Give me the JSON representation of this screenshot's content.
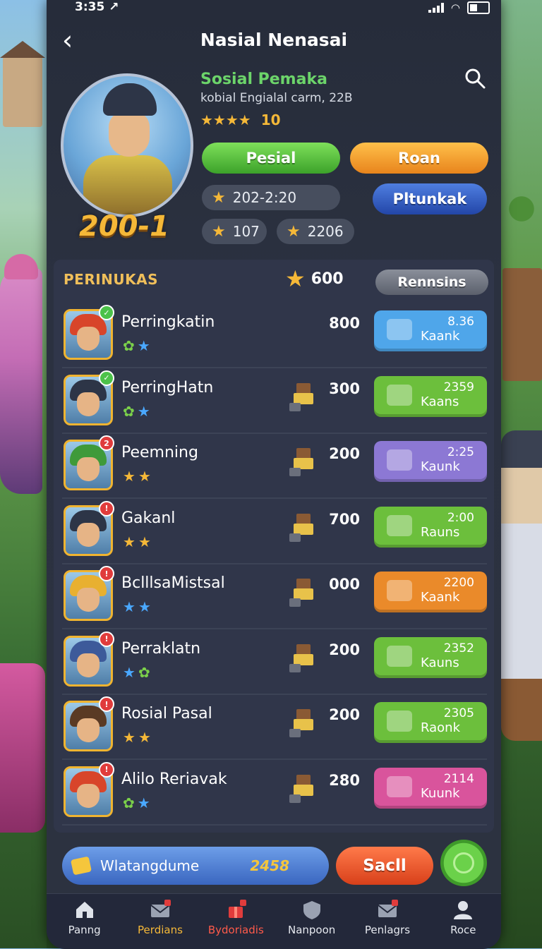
{
  "status": {
    "time": "3:35 ↗"
  },
  "header": {
    "back_icon": "chevron-left-icon",
    "title": "Nasial Nenasai",
    "search_icon": "search-icon"
  },
  "profile": {
    "level": "200-1",
    "name": "Sosial Pemaka",
    "subtitle": "kobial Engialal carm, 22B",
    "stars": "★★★★",
    "rating": "10",
    "btn_primary": "Pesial",
    "btn_secondary": "Roan",
    "btn_tertiary": "Pltunkak",
    "date_chip": "202-2:20",
    "stat_a": "107",
    "stat_b": "2206"
  },
  "section": {
    "title": "PERINUKAS",
    "score": "600",
    "button": "Rennsins"
  },
  "rows": [
    {
      "name": "Perringkatin",
      "score": "800",
      "time": "8.36",
      "action": "Kaank",
      "btn_color": "#4fa6ea",
      "icons": [
        "g",
        "b"
      ],
      "badge": "green",
      "badge_text": "✓",
      "hair": "#d8452a"
    },
    {
      "name": "PerringHatn",
      "score": "300",
      "time": "2359",
      "action": "Kaans",
      "btn_color": "#6cbf3c",
      "icons": [
        "g",
        "b"
      ],
      "badge": "green",
      "badge_text": "✓",
      "hair": "#2d3547"
    },
    {
      "name": "Peemning",
      "score": "200",
      "time": "2:25",
      "action": "Kaunk",
      "btn_color": "#8c78d4",
      "icons": [
        "y",
        "y"
      ],
      "badge": "red",
      "badge_text": "2",
      "hair": "#3f9a3a"
    },
    {
      "name": "Gakanl",
      "score": "700",
      "time": "2:00",
      "action": "Rauns",
      "btn_color": "#6cbf3c",
      "icons": [
        "y",
        "y"
      ],
      "badge": "red",
      "badge_text": "!",
      "hair": "#2d3547"
    },
    {
      "name": "BclllsaMistsal",
      "score": "000",
      "time": "2200",
      "action": "Kaank",
      "btn_color": "#ea8a2a",
      "icons": [
        "b",
        "b"
      ],
      "badge": "red",
      "badge_text": "!",
      "hair": "#e8b030"
    },
    {
      "name": "Perraklatn",
      "score": "200",
      "time": "2352",
      "action": "Kauns",
      "btn_color": "#6cbf3c",
      "icons": [
        "b",
        "g"
      ],
      "badge": "red",
      "badge_text": "!",
      "hair": "#3d5a9a"
    },
    {
      "name": "Rosial Pasal",
      "score": "200",
      "time": "2305",
      "action": "Raonk",
      "btn_color": "#6cbf3c",
      "icons": [
        "y",
        "y"
      ],
      "badge": "red",
      "badge_text": "!",
      "hair": "#5a3a24"
    },
    {
      "name": "Alilo Reriavak",
      "score": "280",
      "time": "2114",
      "action": "Kuunk",
      "btn_color": "#d9549c",
      "icons": [
        "g",
        "b"
      ],
      "badge": "red",
      "badge_text": "!",
      "hair": "#d8452a"
    }
  ],
  "bottom": {
    "label": "Wlatangdume",
    "value": "2458",
    "sell": "Sacll"
  },
  "nav": [
    {
      "label": "Panng",
      "icon": "home-icon"
    },
    {
      "label": "Perdians",
      "icon": "mail-icon"
    },
    {
      "label": "Bydoriadis",
      "icon": "gift-icon"
    },
    {
      "label": "Nanpoon",
      "icon": "shield-icon"
    },
    {
      "label": "Penlagrs",
      "icon": "mail-icon"
    },
    {
      "label": "Roce",
      "icon": "profile-icon"
    }
  ],
  "colors": {
    "accent_green": "#6cd46a",
    "accent_gold": "#f5b838",
    "panel_bg": "#2b3140"
  }
}
